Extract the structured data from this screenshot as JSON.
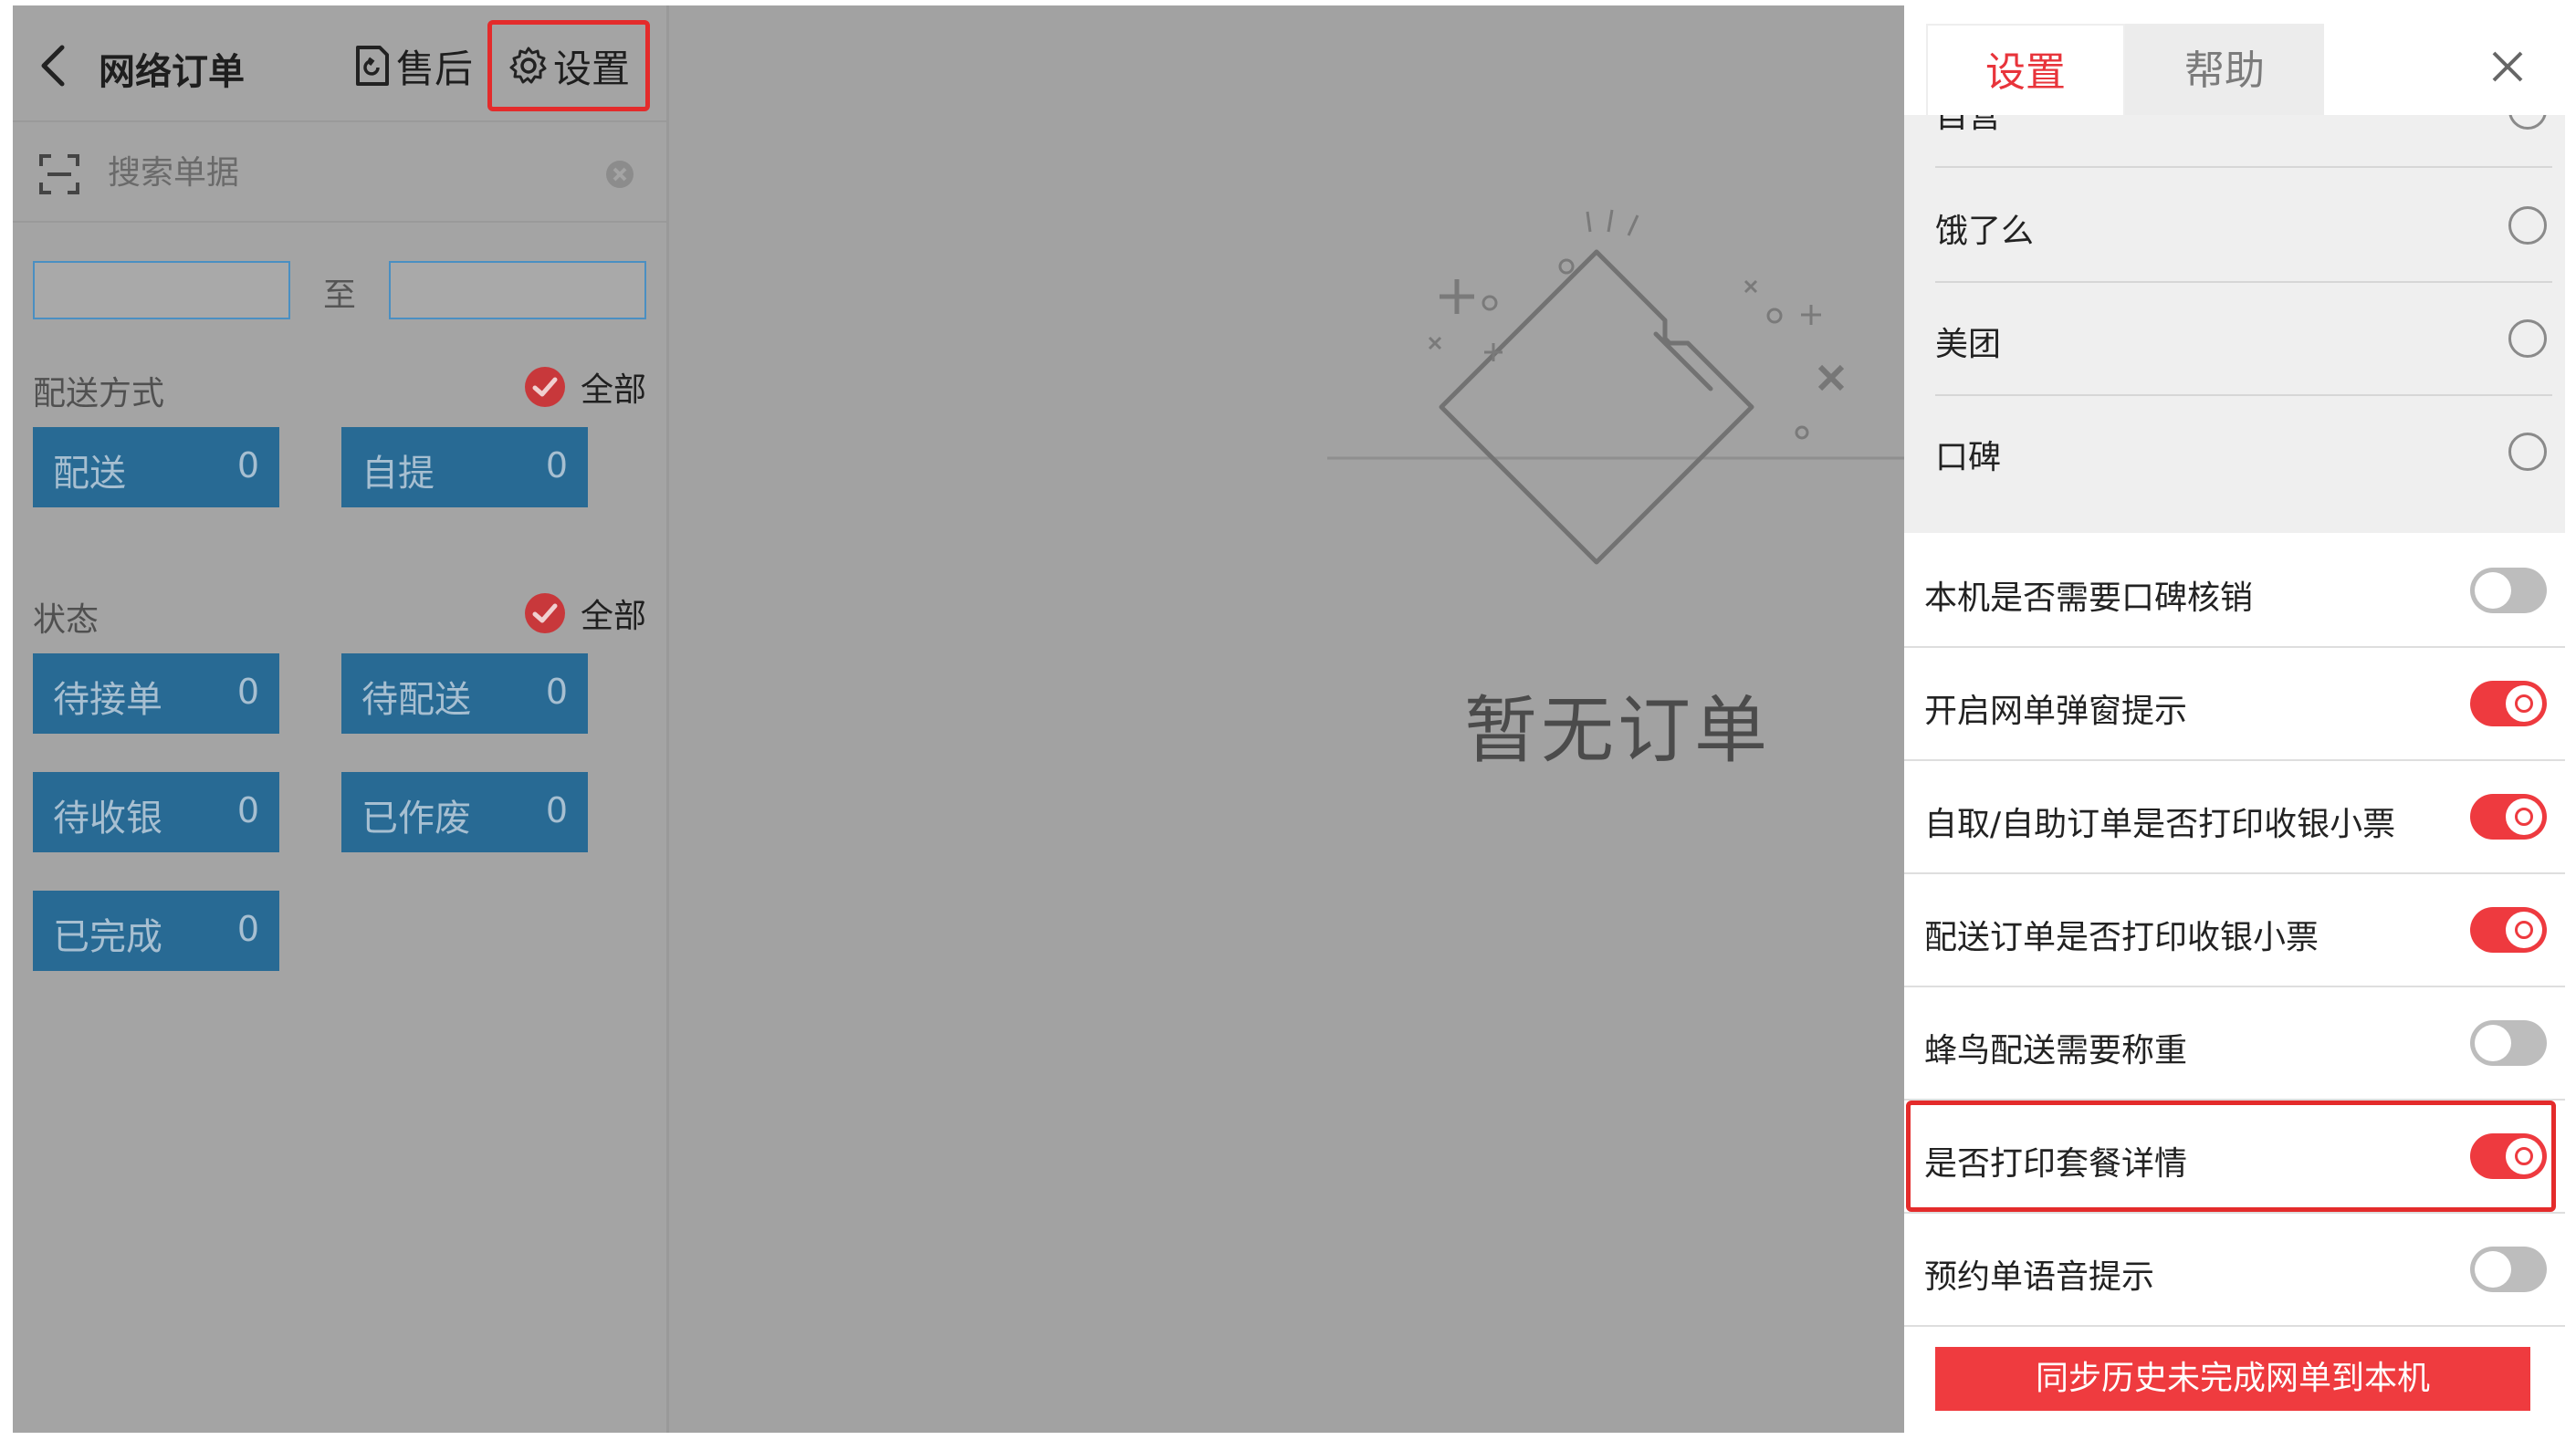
{
  "top_bar": {
    "title": "网络订单",
    "after_sale_label": "售后",
    "settings_label": "设置"
  },
  "search": {
    "placeholder": "搜索单据"
  },
  "date_range": {
    "separator": "至"
  },
  "delivery_section": {
    "label": "配送方式",
    "all_label": "全部",
    "buttons": [
      {
        "label": "配送",
        "count": "0"
      },
      {
        "label": "自提",
        "count": "0"
      }
    ]
  },
  "status_section": {
    "label": "状态",
    "all_label": "全部",
    "buttons": [
      {
        "label": "待接单",
        "count": "0"
      },
      {
        "label": "待配送",
        "count": "0"
      },
      {
        "label": "待收银",
        "count": "0"
      },
      {
        "label": "已作废",
        "count": "0"
      },
      {
        "label": "已完成",
        "count": "0"
      }
    ]
  },
  "empty_state": {
    "text": "暂无订单"
  },
  "settings_panel": {
    "tabs": [
      {
        "label": "设置",
        "active": true
      },
      {
        "label": "帮助",
        "active": false
      }
    ],
    "radio_items": [
      {
        "label": "自营",
        "selected": false
      },
      {
        "label": "饿了么",
        "selected": false
      },
      {
        "label": "美团",
        "selected": false
      },
      {
        "label": "口碑",
        "selected": false
      }
    ],
    "toggles": [
      {
        "label": "本机是否需要口碑核销",
        "on": false
      },
      {
        "label": "开启网单弹窗提示",
        "on": true
      },
      {
        "label": "自取/自助订单是否打印收银小票",
        "on": true
      },
      {
        "label": "配送订单是否打印收银小票",
        "on": true
      },
      {
        "label": "蜂鸟配送需要称重",
        "on": false
      },
      {
        "label": "是否打印套餐详情",
        "on": true
      },
      {
        "label": "预约单语音提示",
        "on": false
      }
    ],
    "sync_button_label": "同步历史未完成网单到本机"
  },
  "colors": {
    "accent_red": "#ee3a3f",
    "filter_blue": "#286a94",
    "highlight_red": "#e42b2b"
  }
}
